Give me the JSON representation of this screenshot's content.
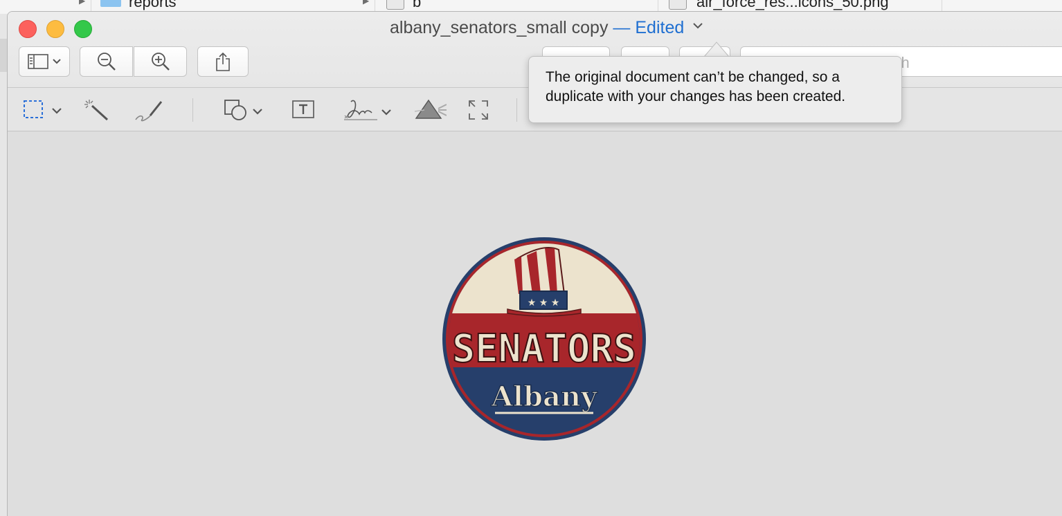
{
  "background_finder": {
    "folder_name": "reports",
    "file_partial": "b",
    "file_name": "air_force_res...icons_50.png"
  },
  "window": {
    "title": "albany_senators_small copy",
    "edited_label": "— Edited",
    "title_chevron_icon": "chevron-down-icon"
  },
  "toolbar": {
    "sidebar_button_icon": "sidebar-icon",
    "zoom_out_icon": "zoom-out-icon",
    "zoom_in_icon": "zoom-in-icon",
    "share_icon": "share-icon",
    "search_placeholder": "Search"
  },
  "markup_toolbar": {
    "tools": [
      {
        "name": "selection-tool",
        "icon": "rect-selection-icon"
      },
      {
        "name": "instant-alpha",
        "icon": "magic-wand-icon"
      },
      {
        "name": "sketch",
        "icon": "sketch-icon"
      },
      {
        "name": "shapes",
        "icon": "shapes-icon"
      },
      {
        "name": "text",
        "icon": "text-box-icon"
      },
      {
        "name": "sign",
        "icon": "signature-icon"
      },
      {
        "name": "adjust-color",
        "icon": "prism-icon"
      },
      {
        "name": "adjust-size",
        "icon": "resize-icon"
      }
    ]
  },
  "popover": {
    "message": "The original document can’t be changed, so a duplicate with your changes has been created."
  },
  "image": {
    "team_text": "SENATORS",
    "city_text": "Albany",
    "colors": {
      "navy": "#263f6b",
      "red": "#a8262b",
      "cream": "#ece3cd"
    }
  }
}
